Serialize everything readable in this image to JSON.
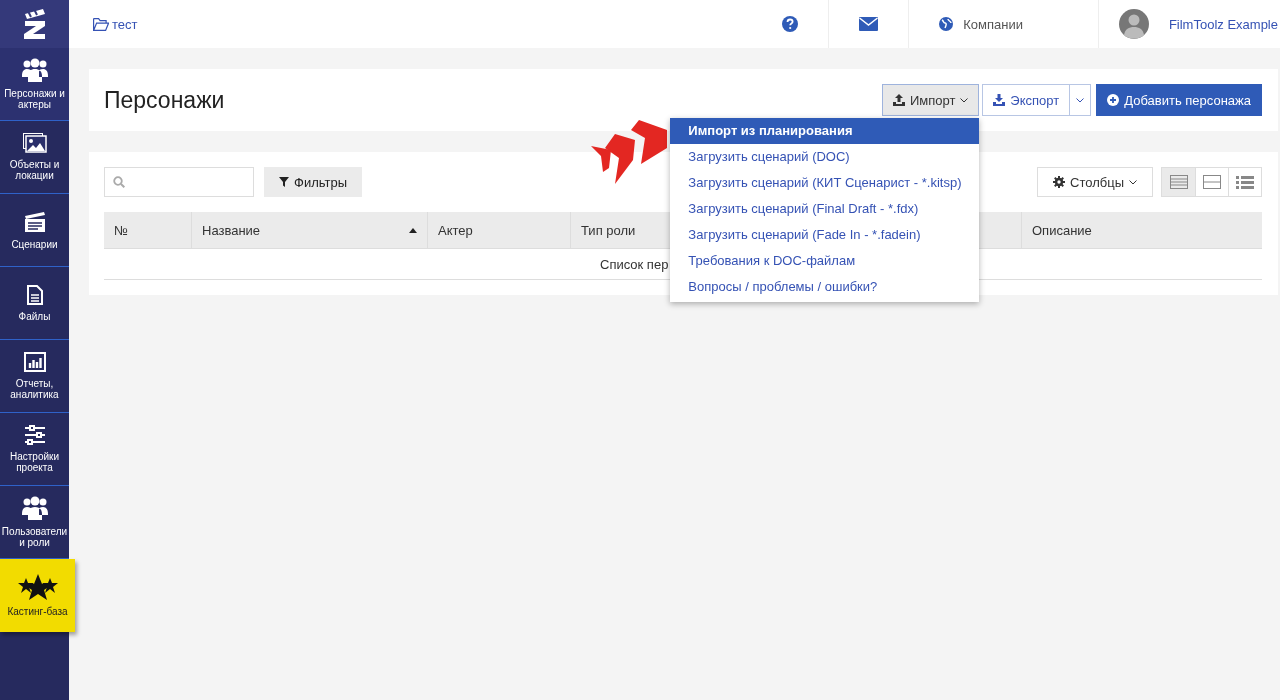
{
  "sidebar": {
    "items": [
      {
        "label": "Персонажи и актеры",
        "kind": "nav",
        "selected": true
      },
      {
        "label": "Объекты и локации",
        "kind": "nav",
        "selected": false
      },
      {
        "label": "Сценарии",
        "kind": "nav",
        "selected": false
      },
      {
        "label": "Файлы",
        "kind": "nav",
        "selected": false
      },
      {
        "label": "Отчеты, аналитика",
        "kind": "nav",
        "selected": false
      },
      {
        "label": "Настройки проекта",
        "kind": "nav",
        "selected": false
      },
      {
        "label": "Пользователи и роли",
        "kind": "nav",
        "selected": false
      },
      {
        "label": "Кастинг-база",
        "kind": "promo",
        "selected": false
      }
    ]
  },
  "topbar": {
    "breadcrumb": "тест",
    "companies": "Компании",
    "user": "FilmToolz Example"
  },
  "header": {
    "title": "Персонажи",
    "import": {
      "label": "Импорт",
      "expanded": true
    },
    "export": "Экспорт",
    "add": "Добавить персонажа"
  },
  "import_menu": [
    {
      "label": "Импорт из планирования",
      "selected": true
    },
    {
      "label": "Загрузить сценарий (DOC)",
      "selected": false
    },
    {
      "label": "Загрузить сценарий (КИТ Сценарист - *.kitsp)",
      "selected": false
    },
    {
      "label": "Загрузить сценарий (Final Draft - *.fdx)",
      "selected": false
    },
    {
      "label": "Загрузить сценарий (Fade In - *.fadein)",
      "selected": false
    },
    {
      "label": "Требования к DOC-файлам",
      "selected": false
    },
    {
      "label": "Вопросы / проблемы / ошибки?",
      "selected": false
    }
  ],
  "toolbar": {
    "filters": "Фильтры",
    "columns": "Столбцы",
    "views": [
      {
        "selected": true
      },
      {
        "selected": false
      },
      {
        "selected": false
      }
    ]
  },
  "table": {
    "columns": [
      {
        "label": "№",
        "sorted": false
      },
      {
        "label": "Название",
        "sorted": true
      },
      {
        "label": "Актер",
        "sorted": false
      },
      {
        "label": "Тип роли",
        "sorted": false
      },
      {
        "label": "Описание",
        "sorted": false
      }
    ],
    "empty_text": "Список пер"
  }
}
